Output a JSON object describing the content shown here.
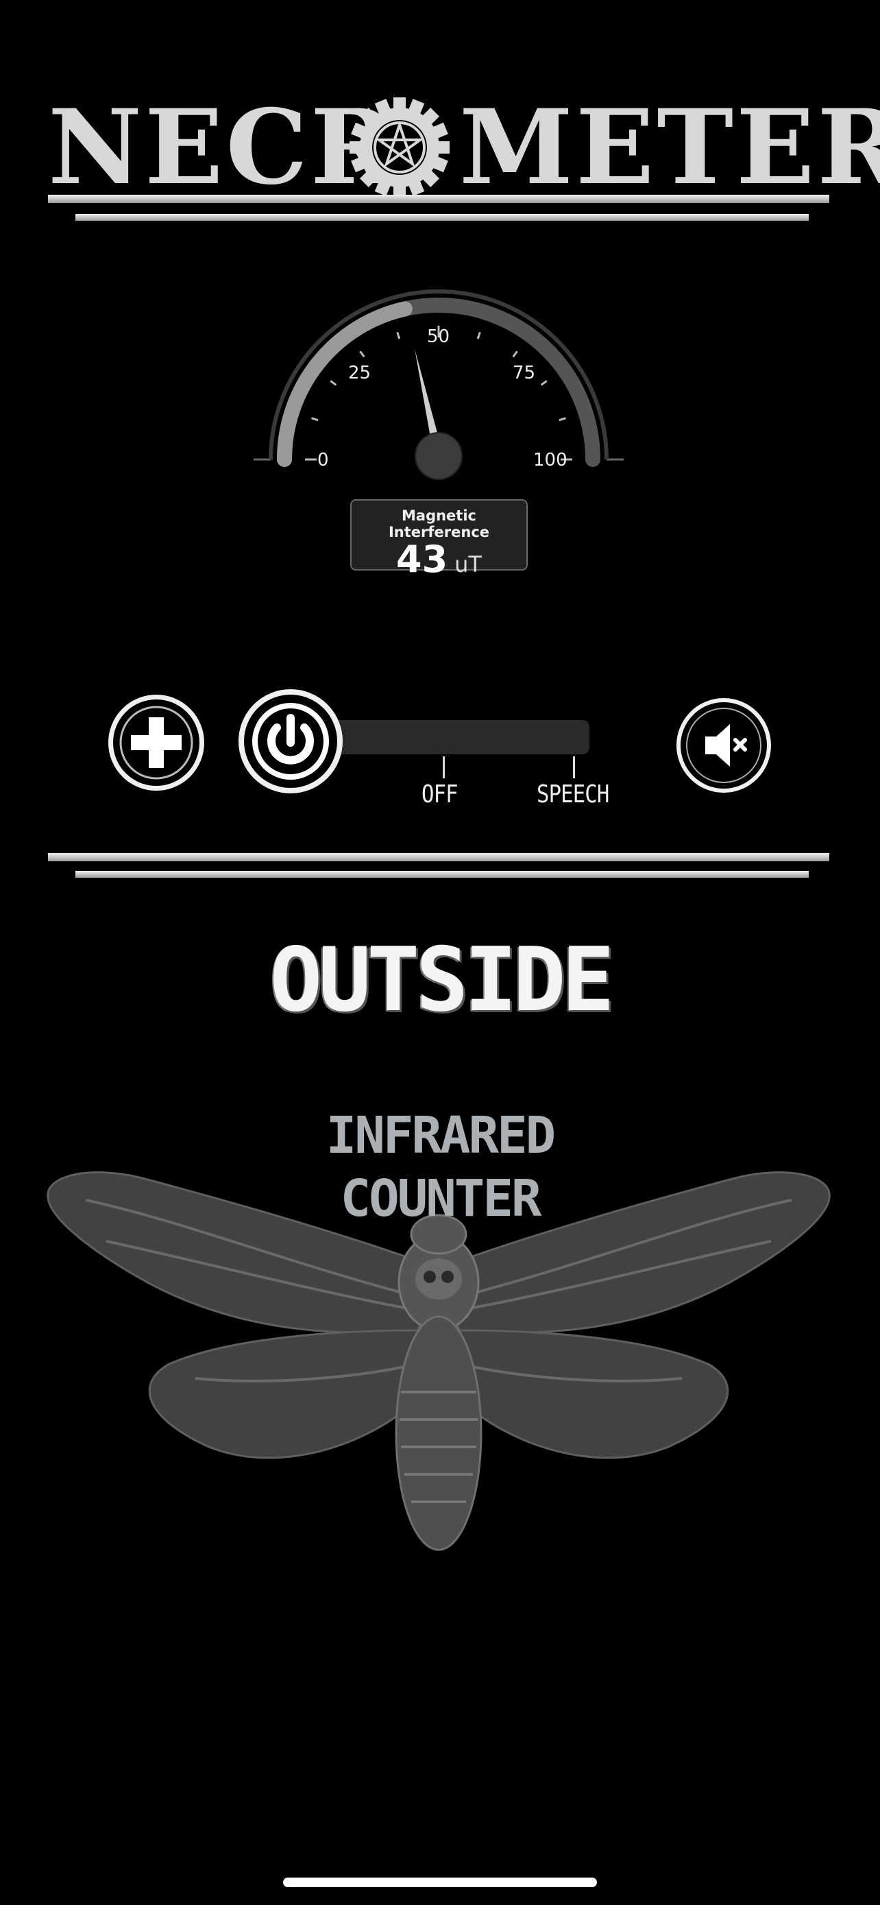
{
  "header": {
    "title_left": "NECR",
    "title_right": "METER",
    "logo_icon": "pentagram-gear-icon"
  },
  "gauge": {
    "min_label": "0",
    "tick_labels": [
      "0",
      "25",
      "50",
      "75",
      "100"
    ],
    "max_value": 100,
    "value": 43,
    "readout_label": "Magnetic Interference",
    "readout_value": "43",
    "readout_unit": "uT"
  },
  "controls": {
    "add_icon": "plus-icon",
    "power_icon": "power-icon",
    "mute_icon": "speaker-muted-icon",
    "slider_labels": [
      "OFF",
      "SPEECH"
    ],
    "slider_position": "off"
  },
  "mode": {
    "label": "OUTSIDE"
  },
  "counter": {
    "title_line1": "INFRARED",
    "title_line2": "COUNTER",
    "background_icon": "deaths-head-moth-icon"
  },
  "colors": {
    "background": "#000000",
    "foreground": "#f2f2f2",
    "track": "#2a2a2a",
    "counter_text": "#aab0b4"
  }
}
